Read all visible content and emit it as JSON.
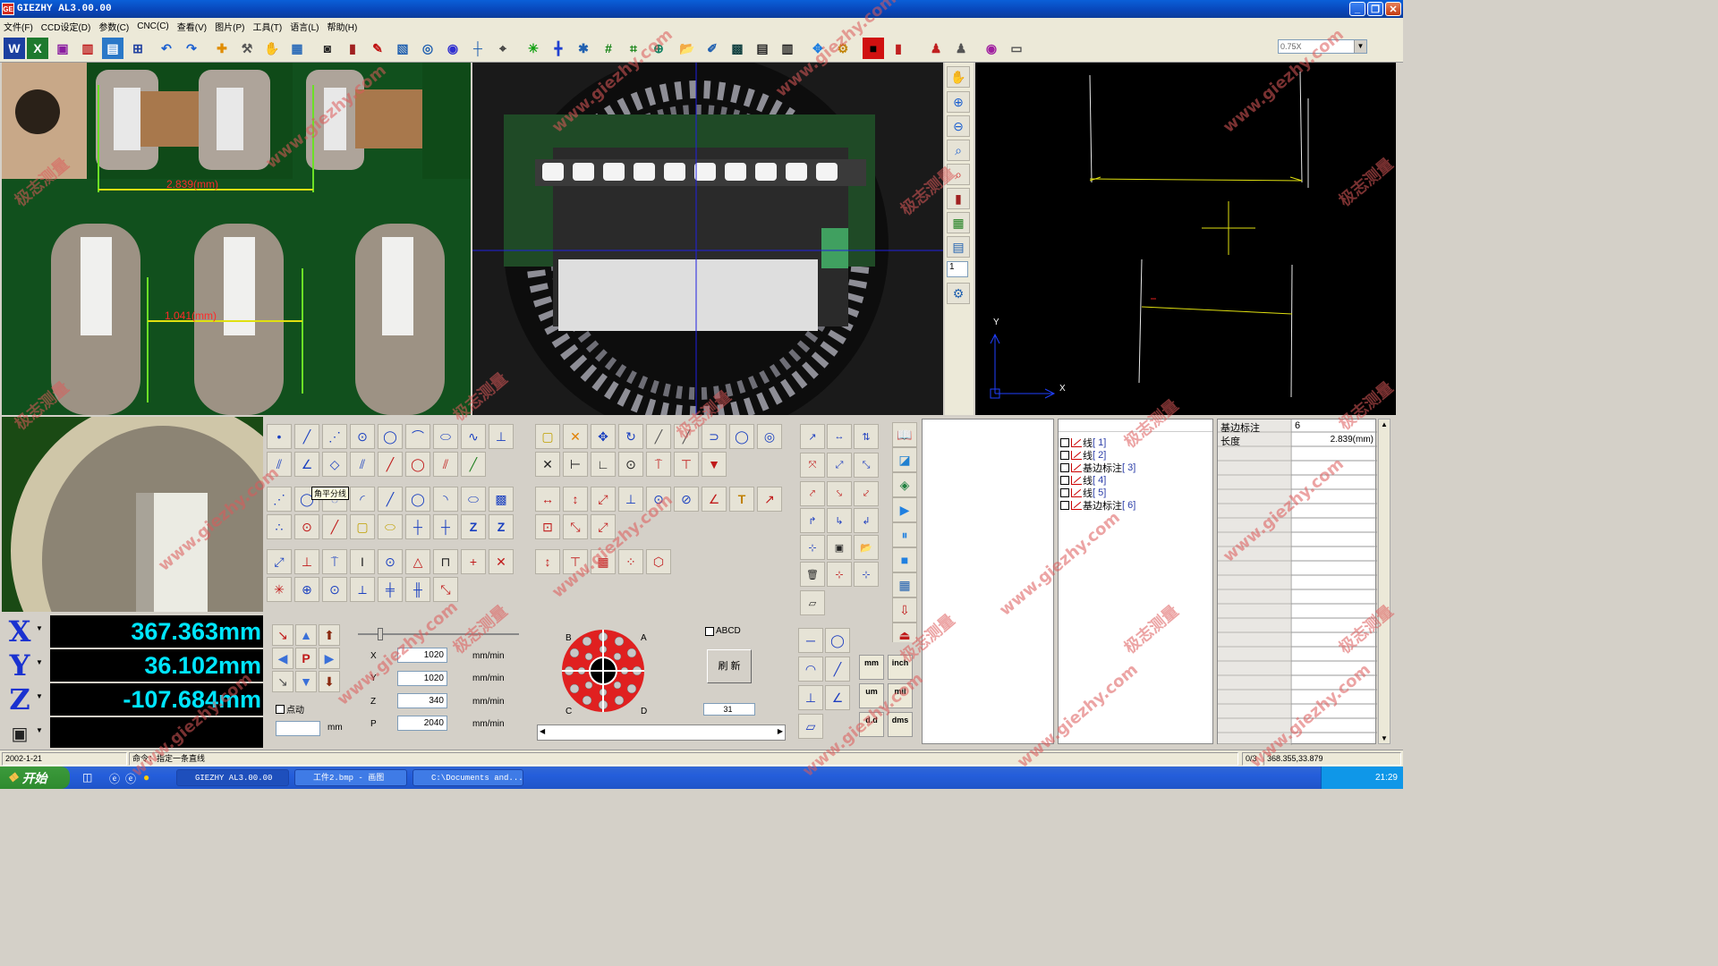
{
  "window": {
    "title": "GIEZHY AL3.00.00",
    "app_icon": "GE"
  },
  "menu": [
    "文件(F)",
    "CCD设定(D)",
    "参数(C)",
    "CNC(C)",
    "查看(V)",
    "图片(P)",
    "工具(T)",
    "语言(L)",
    "帮助(H)"
  ],
  "toolbar": {
    "zoom": "0.75X"
  },
  "measure": {
    "m1": "2.839(mm)",
    "m2": "1.041(mm)"
  },
  "graph": {
    "axis_x": "X",
    "axis_y": "Y"
  },
  "tooltip": "角平分线",
  "coords": {
    "x_label": "X",
    "y_label": "Y",
    "z_label": "Z",
    "x": "367.363mm",
    "y": "36.102mm",
    "z": "-107.684mm"
  },
  "speed": {
    "x": "1020",
    "y": "1020",
    "z": "340",
    "p": "2040",
    "unit": "mm/min",
    "jog": "点动",
    "mm": "mm",
    "labels": [
      "X",
      "Y",
      "Z",
      "P"
    ]
  },
  "light": {
    "a": "A",
    "b": "B",
    "c": "C",
    "d": "D",
    "abcd": "ABCD",
    "refresh": "刷 新",
    "value": "31"
  },
  "units": {
    "mm": "mm",
    "inch": "inch",
    "um": "um",
    "mil": "mil",
    "dd": "d.d",
    "dms": "dms"
  },
  "elements": [
    {
      "name": "线",
      "idx": "[ 1]"
    },
    {
      "name": "线",
      "idx": "[ 2]"
    },
    {
      "name": "基边标注",
      "idx": "[ 3]"
    },
    {
      "name": "线",
      "idx": "[ 4]"
    },
    {
      "name": "线",
      "idx": "[ 5]"
    },
    {
      "name": "基边标注",
      "idx": "[ 6]"
    }
  ],
  "props": {
    "k1": "基边标注",
    "v1": "6",
    "k2": "长度",
    "v2": "2.839(mm)"
  },
  "status": {
    "date": "2002-1-21",
    "command": "命令：指定一条直线",
    "count": "0/3",
    "pos": "368.355,33.879"
  },
  "taskbar": {
    "start": "开始",
    "t1": "GIEZHY AL3.00.00",
    "t2": "工件2.bmp - 画图",
    "t3": "C:\\Documents and...",
    "time": "21:29"
  },
  "vtb_num": "1",
  "watermark": [
    "极志测量",
    "www.giezhy.com"
  ]
}
